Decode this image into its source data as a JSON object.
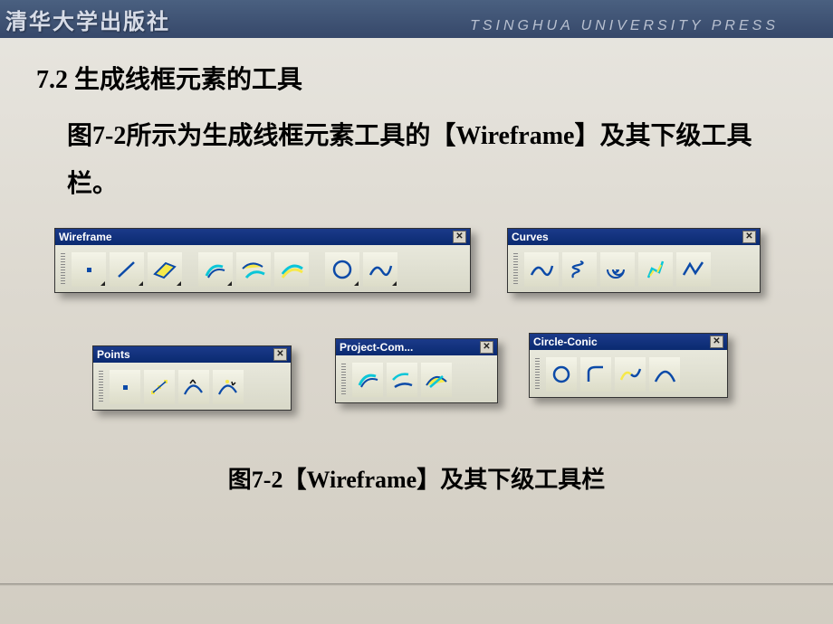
{
  "header": {
    "publisher_cn": "清华大学出版社",
    "publisher_en": "TSINGHUA UNIVERSITY PRESS"
  },
  "section": {
    "number": "7.2",
    "title": "生成线框元素的工具",
    "body": "图7-2所示为生成线框元素工具的【Wireframe】及其下级工具栏。"
  },
  "caption": "图7-2【Wireframe】及其下级工具栏",
  "toolbars": {
    "wireframe": {
      "title": "Wireframe",
      "icons": [
        "point",
        "line",
        "plane",
        "project",
        "intersect",
        "parallel",
        "circle",
        "spline"
      ]
    },
    "curves": {
      "title": "Curves",
      "icons": [
        "spline",
        "helix",
        "spiral",
        "spine",
        "polyline"
      ]
    },
    "points": {
      "title": "Points",
      "icons": [
        "point",
        "points-repetition",
        "extremum",
        "extremum-polar"
      ]
    },
    "project": {
      "title": "Project-Com...",
      "icons": [
        "project",
        "combine",
        "reflect-line"
      ]
    },
    "circle": {
      "title": "Circle-Conic",
      "icons": [
        "circle",
        "corner",
        "connect",
        "conic"
      ]
    }
  }
}
